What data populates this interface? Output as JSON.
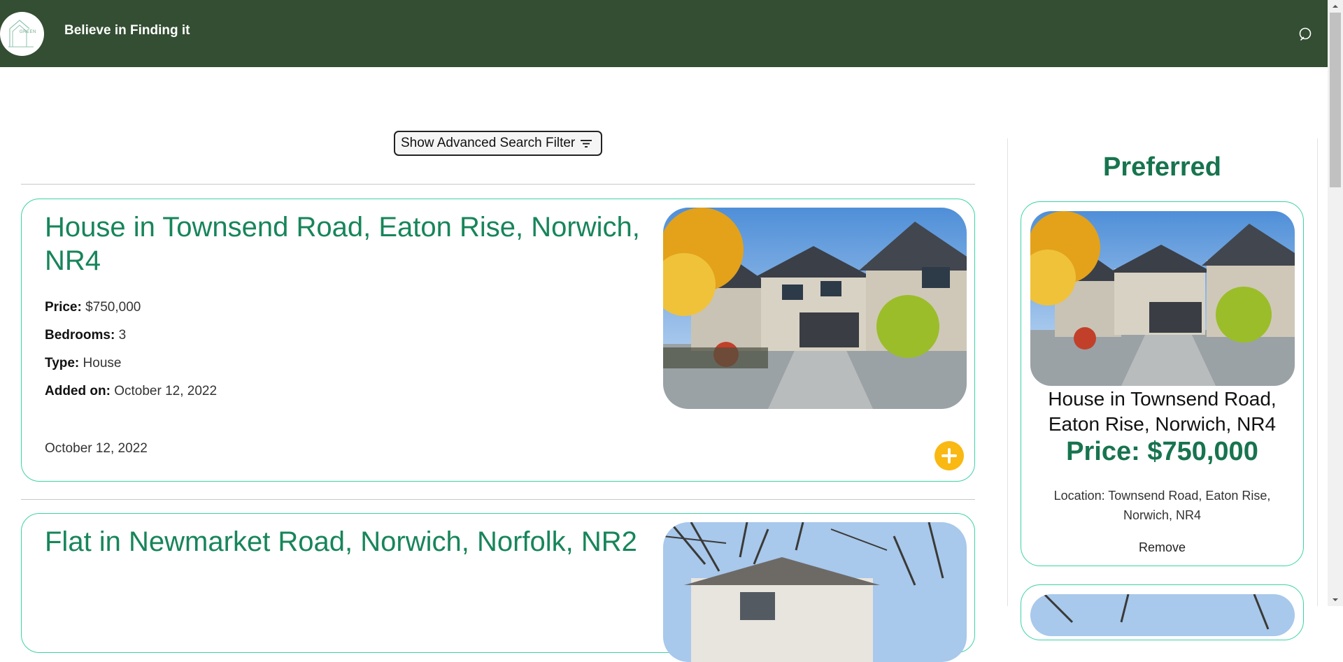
{
  "header": {
    "logo_text": "GREEN",
    "tagline": "Believe in Finding it",
    "search_icon": "search-icon",
    "background": "#334e32"
  },
  "filter": {
    "label": "Show Advanced Search Filter",
    "icon": "filter-icon"
  },
  "listings": [
    {
      "title": "House in Townsend Road, Eaton Rise, Norwich, NR4",
      "price_label": "Price:",
      "price": "$750,000",
      "bedrooms_label": "Bedrooms:",
      "bedrooms": "3",
      "type_label": "Type:",
      "type": "House",
      "added_label": "Added on:",
      "added": "October 12, 2022",
      "footer_date": "October 12, 2022"
    },
    {
      "title": "Flat in Newmarket Road, Norwich, Norfolk, NR2"
    }
  ],
  "preferred": {
    "heading": "Preferred",
    "items": [
      {
        "name": "House in Townsend Road, Eaton Rise, Norwich, NR4",
        "price": "Price: $750,000",
        "location": "Location: Townsend Road, Eaton Rise, Norwich, NR4",
        "remove_label": "Remove"
      }
    ]
  },
  "colors": {
    "accent_green": "#17855a",
    "card_border": "#3cd3a4",
    "add_button": "#f9b812"
  }
}
